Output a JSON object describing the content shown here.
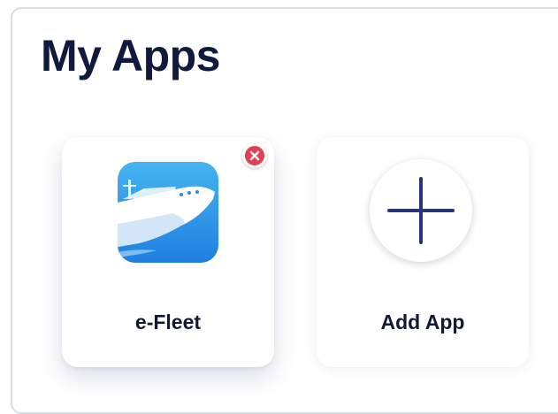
{
  "page": {
    "title": "My Apps"
  },
  "apps": [
    {
      "name": "e-Fleet",
      "icon": "ship-icon",
      "icon_colors": [
        "#46b4f1",
        "#1f7fe0"
      ]
    }
  ],
  "add_app": {
    "label": "Add App",
    "icon": "plus-icon",
    "icon_color": "#24357a"
  },
  "colors": {
    "title": "#101a3c",
    "remove_badge": "#e13f52",
    "panel_border": "#d9dce3"
  }
}
